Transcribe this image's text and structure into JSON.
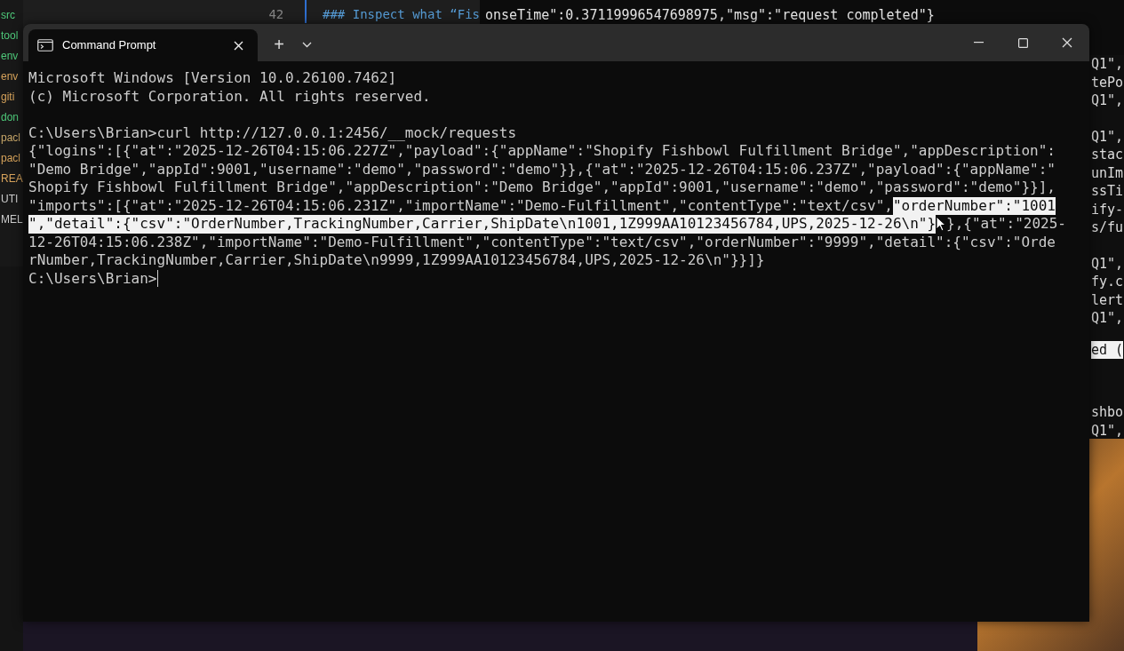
{
  "background": {
    "sidebar_items": [
      {
        "text": "src",
        "color": "#4ec97a"
      },
      {
        "text": "tool",
        "color": "#4ec97a"
      },
      {
        "text": "env",
        "color": "#4ec97a"
      },
      {
        "text": "env",
        "color": "#d7a35b"
      },
      {
        "text": "giti",
        "color": "#d7a35b"
      },
      {
        "text": "don",
        "color": "#4ec97a"
      },
      {
        "text": "pacl",
        "color": "#c9a86a"
      },
      {
        "text": "pacl",
        "color": "#d7a35b"
      },
      {
        "text": "REA",
        "color": "#d7a35b"
      },
      {
        "text": "UTI",
        "color": "#cccccc"
      },
      {
        "text": "MEL",
        "color": "#cccccc"
      }
    ],
    "editor": {
      "line_number": "42",
      "line_text": "### Inspect what “Fis"
    },
    "log_line": "onseTime\":0.37119996547698975,\"msg\":\"request completed\"}",
    "right_groups": [
      {
        "lines": [
          {
            "text": "Q1\",",
            "selected": false
          },
          {
            "text": "tePo",
            "selected": false
          },
          {
            "text": "Q1\",",
            "selected": false
          }
        ]
      },
      {
        "lines": [
          {
            "text": "Q1\",",
            "selected": false
          },
          {
            "text": "stac",
            "selected": false
          },
          {
            "text": "unIm",
            "selected": false
          },
          {
            "text": "ssTi",
            "selected": false
          },
          {
            "text": "ify-",
            "selected": false
          },
          {
            "text": "s/fu",
            "selected": false
          }
        ]
      },
      {
        "lines": [
          {
            "text": "Q1\",",
            "selected": false
          },
          {
            "text": "fy.c",
            "selected": false
          },
          {
            "text": "lert",
            "selected": false
          },
          {
            "text": "Q1\",",
            "selected": false
          }
        ]
      },
      {
        "lines": [
          {
            "text": "ed (",
            "selected": true
          }
        ]
      },
      {
        "lines": [
          {
            "text": "shbo",
            "selected": false
          },
          {
            "text": "Q1\",",
            "selected": false
          }
        ]
      }
    ]
  },
  "window": {
    "tabs": [
      {
        "title": "Command Prompt",
        "selected": true
      }
    ],
    "new_tab": "+"
  },
  "terminal": {
    "blocks": [
      [
        [
          {
            "text": "Microsoft Windows [Version 10.0.26100.7462]",
            "selected": false
          }
        ],
        [
          {
            "text": "(c) Microsoft Corporation. All rights reserved.",
            "selected": false
          }
        ]
      ],
      [
        [
          {
            "text": "C:\\Users\\Brian>curl http://127.0.0.1:2456/__mock/requests",
            "selected": false
          }
        ],
        [
          {
            "text": "{\"logins\":[{\"at\":\"2025-12-26T04:15:06.227Z\",\"payload\":{\"appName\":\"Shopify Fishbowl Fulfillment Bridge\",\"appDescription\":",
            "selected": false
          }
        ],
        [
          {
            "text": "\"Demo Bridge\",\"appId\":9001,\"username\":\"demo\",\"password\":\"demo\"}},{\"at\":\"2025-12-26T04:15:06.237Z\",\"payload\":{\"appName\":\"",
            "selected": false
          }
        ],
        [
          {
            "text": "Shopify Fishbowl Fulfillment Bridge\",\"appDescription\":\"Demo Bridge\",\"appId\":9001,\"username\":\"demo\",\"password\":\"demo\"}}],",
            "selected": false
          }
        ],
        [
          {
            "text": "\"imports\":[{\"at\":\"2025-12-26T04:15:06.231Z\",\"importName\":\"Demo-Fulfillment\",\"contentType\":\"text/csv\",",
            "selected": false
          },
          {
            "text": "\"orderNumber\":\"1001",
            "selected": true
          }
        ],
        [
          {
            "text": "\",\"detail\":{\"csv\":\"OrderNumber,TrackingNumber,Carrier,ShipDate\\n1001,1Z999AA10123456784,UPS,2025-12-26\\n\"}",
            "selected": true
          },
          {
            "text": "},{\"at\":\"2025-",
            "selected": false
          }
        ],
        [
          {
            "text": "12-26T04:15:06.238Z\",\"importName\":\"Demo-Fulfillment\",\"contentType\":\"text/csv\",\"orderNumber\":\"9999\",\"detail\":{\"csv\":\"Orde",
            "selected": false
          }
        ],
        [
          {
            "text": "rNumber,TrackingNumber,Carrier,ShipDate\\n9999,1Z999AA10123456784,UPS,2025-12-26\\n\"}}]}",
            "selected": false
          }
        ],
        [
          {
            "text": "C:\\Users\\Brian>",
            "selected": false
          }
        ]
      ]
    ]
  }
}
